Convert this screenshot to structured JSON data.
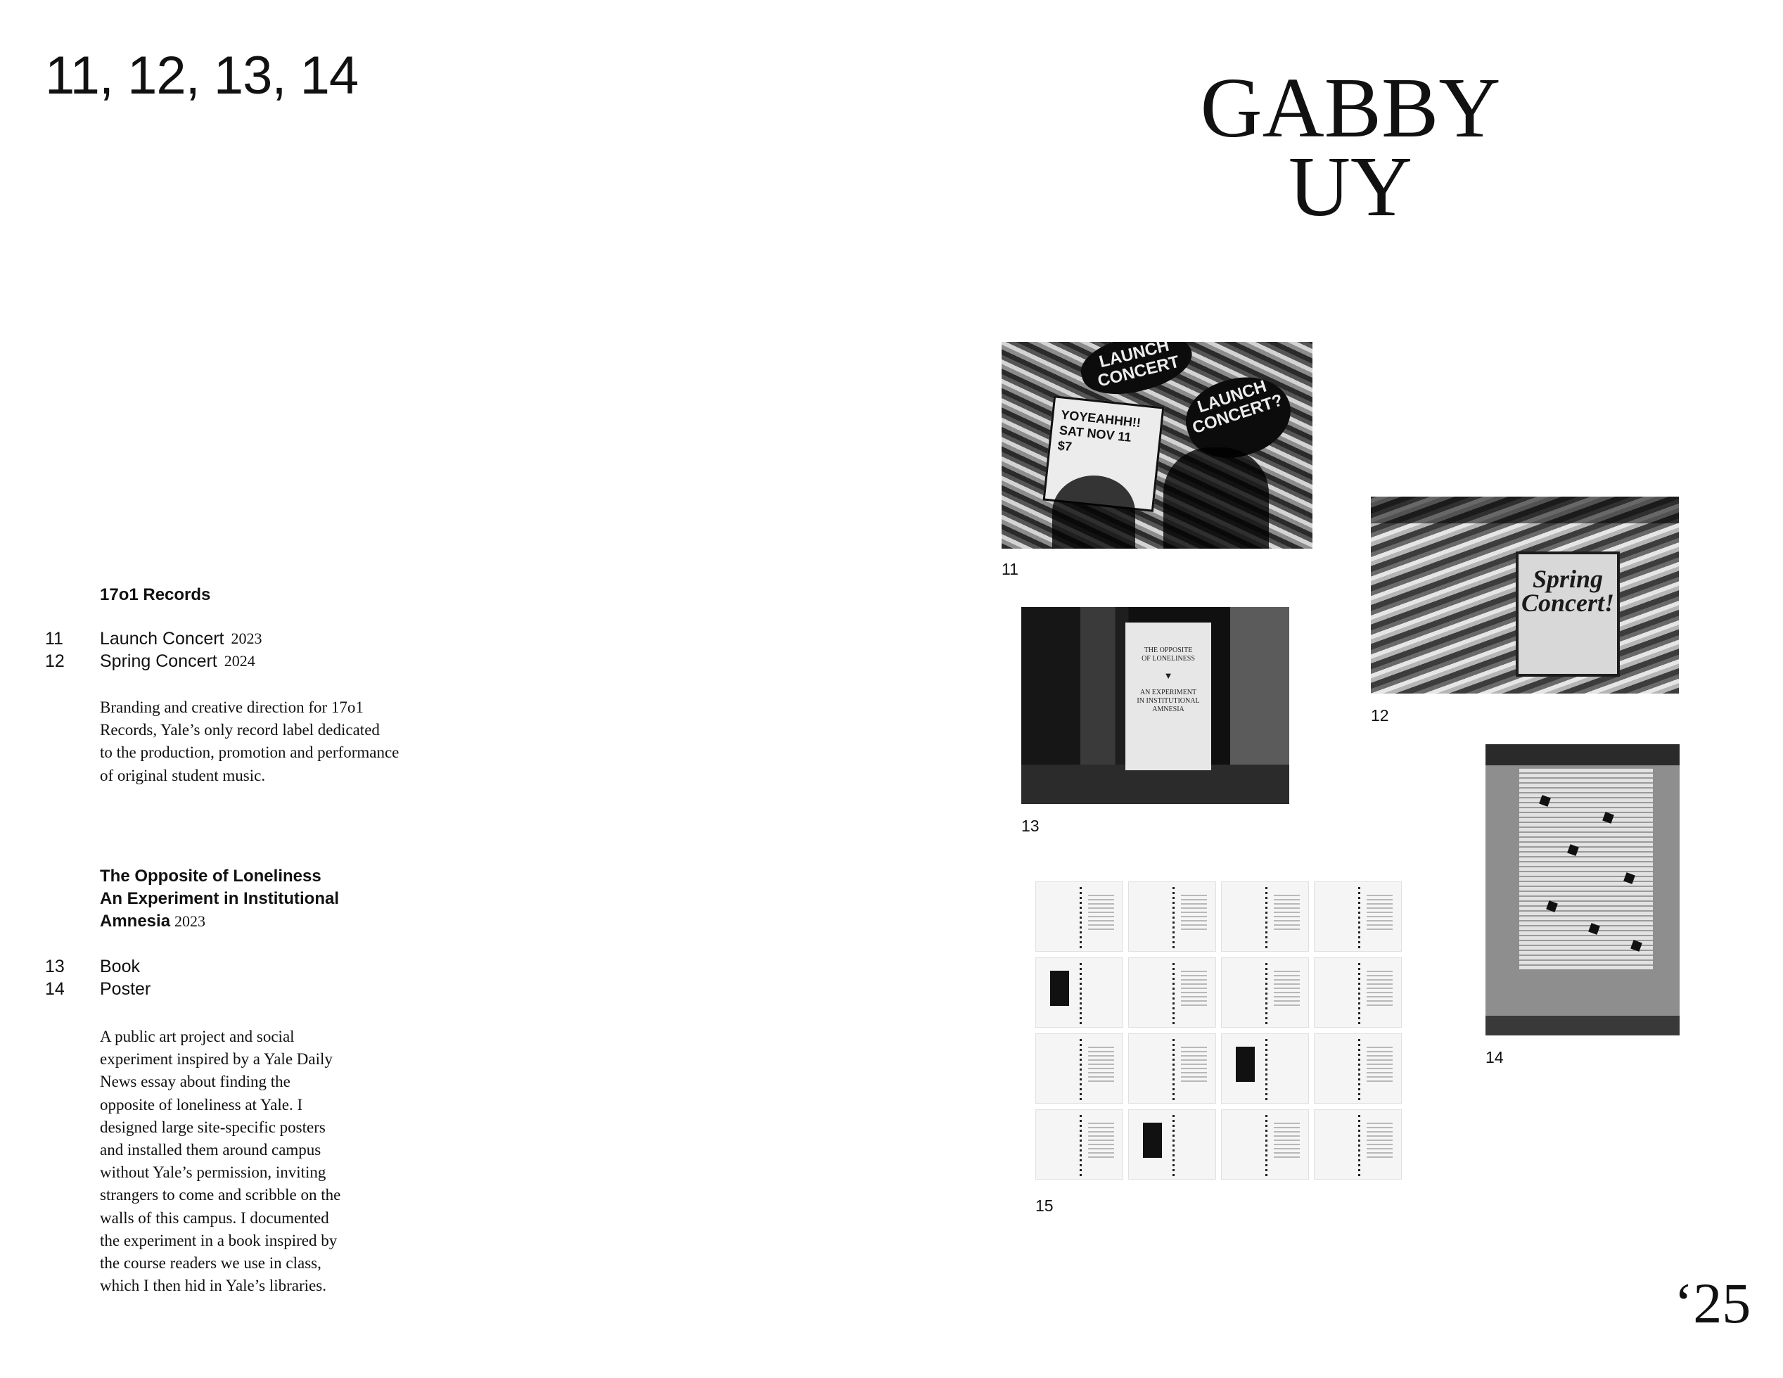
{
  "header": {
    "page_numbers": "11, 12, 13, 14"
  },
  "author": {
    "line1": "GABBY",
    "line2": "UY"
  },
  "year_mark": "‘25",
  "project_1": {
    "title": "17o1 Records",
    "items": [
      {
        "num": "11",
        "name": "Launch Concert",
        "year": "2023"
      },
      {
        "num": "12",
        "name": "Spring Concert",
        "year": "2024"
      }
    ],
    "description_lines": [
      "Branding and creative direction for 17o1",
      "Records, Yale’s only record label dedicated",
      "to the production, promotion and performance",
      "of original student music."
    ]
  },
  "project_2": {
    "title_lines": [
      "The Opposite of Loneliness",
      "An Experiment in Institutional",
      "Amnesia"
    ],
    "year": "2023",
    "items": [
      {
        "num": "13",
        "name": "Book"
      },
      {
        "num": "14",
        "name": "Poster"
      }
    ],
    "description_lines": [
      "A public art project and social",
      "experiment inspired by a Yale Daily",
      "News essay about finding the",
      "opposite of loneliness at Yale. I",
      "designed large site-specific posters",
      "and installed them around campus",
      "without Yale’s permission, inviting",
      "strangers to come and scribble on the",
      "walls of this campus. I documented",
      "the experiment in a book inspired by",
      "the course readers we use in class,",
      "which I then hid in Yale’s libraries."
    ]
  },
  "figures": {
    "captions": {
      "c11": "11",
      "c12": "12",
      "c13": "13",
      "c14": "14",
      "c15": "15"
    },
    "photo_11": {
      "badge_top": "LAUNCH CONCERT",
      "badge_right_1": "LAUNCH",
      "badge_right_2": "CONCERT?",
      "ticket_1": "YOYEAHHH!!",
      "ticket_2": "SAT NOV 11",
      "ticket_3": "$7"
    },
    "photo_12": {
      "poster_line1": "Spring",
      "poster_line2": "Concert!"
    },
    "photo_13": {
      "book_line1": "THE OPPOSITE",
      "book_line2": "OF LONELINESS",
      "book_line3": "AN EXPERIMENT",
      "book_line4": "IN INSTITUTIONAL",
      "book_line5": "AMNESIA"
    }
  }
}
